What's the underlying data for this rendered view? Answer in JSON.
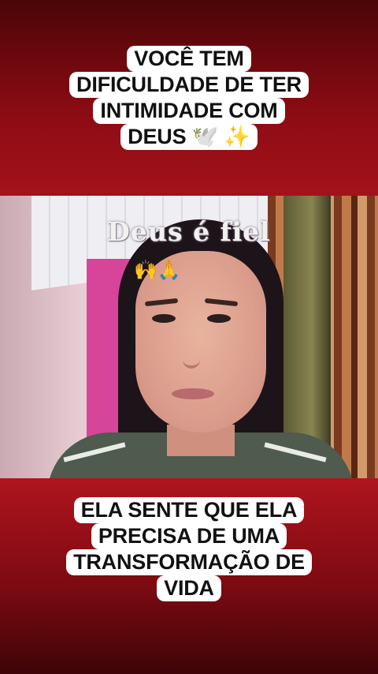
{
  "top_caption": {
    "lines": [
      "VOCÊ TEM",
      "DIFICULDADE DE TER",
      "INTIMIDADE COM",
      "DEUS 🕊️ ✨"
    ]
  },
  "video": {
    "overlay_title": "Deus é fiel",
    "overlay_emoji": "🙌🙏"
  },
  "bottom_caption": {
    "lines": [
      "ELA SENTE QUE ELA",
      "PRECISA DE UMA",
      "TRANSFORMAÇÃO DE",
      "VIDA"
    ]
  },
  "colors": {
    "background_accent": "#a0101a",
    "caption_bg": "#ffffff",
    "caption_text": "#111111"
  }
}
